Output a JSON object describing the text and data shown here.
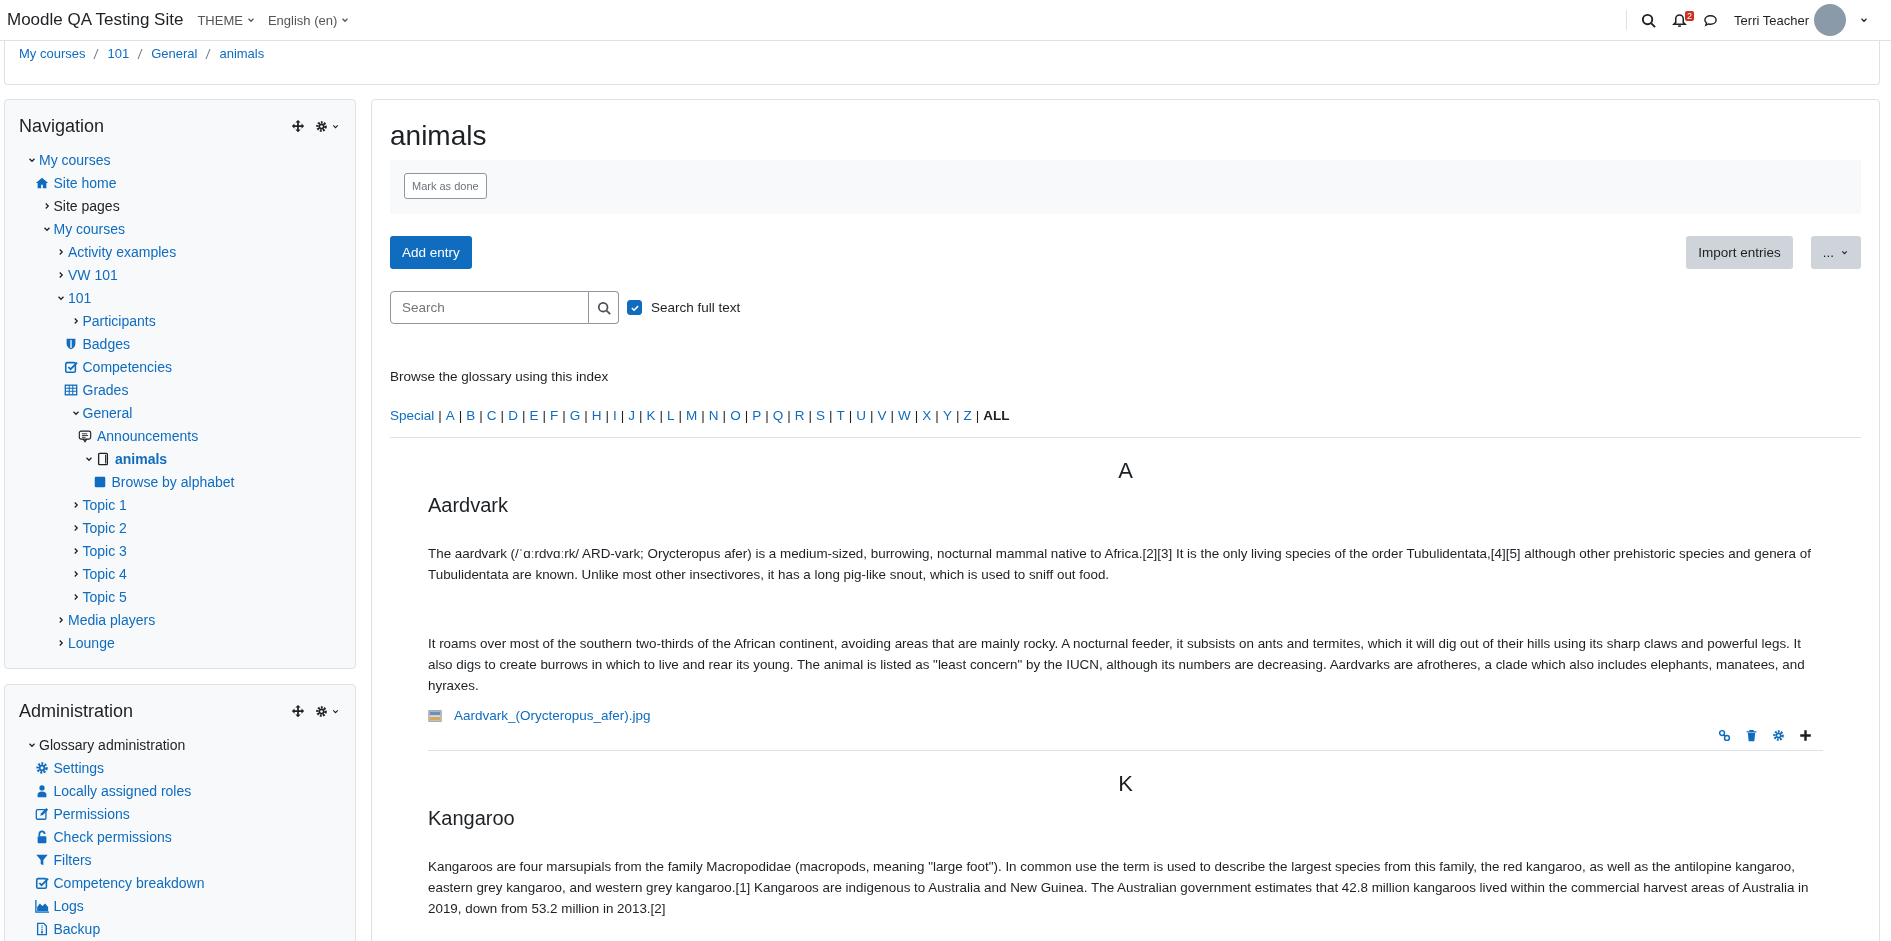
{
  "topbar": {
    "site_name": "Moodle QA Testing Site",
    "menus": [
      {
        "label": "THEME"
      },
      {
        "label": "English (en)"
      }
    ],
    "notification_count": "2",
    "user_name": "Terri Teacher"
  },
  "breadcrumb": [
    "My courses",
    "101",
    "General",
    "animals"
  ],
  "navigation": {
    "title": "Navigation",
    "items": [
      {
        "label": "My courses",
        "link": true,
        "current": false,
        "expanded": true,
        "children": [
          {
            "label": "Site home",
            "kind": "home",
            "link": true,
            "current": false
          },
          {
            "label": "Site pages",
            "link": false,
            "current": false,
            "expanded": false
          },
          {
            "label": "My courses",
            "link": true,
            "current": false,
            "expanded": true,
            "children": [
              {
                "label": "Activity examples",
                "link": true,
                "current": false,
                "expanded": false
              },
              {
                "label": "VW 101",
                "link": true,
                "current": false,
                "expanded": false
              },
              {
                "label": "101",
                "link": true,
                "current": false,
                "expanded": true,
                "children": [
                  {
                    "label": "Participants",
                    "link": true,
                    "current": false,
                    "expanded": false
                  },
                  {
                    "label": "Badges",
                    "kind": "badge",
                    "link": true,
                    "current": false
                  },
                  {
                    "label": "Competencies",
                    "kind": "check",
                    "link": true,
                    "current": false
                  },
                  {
                    "label": "Grades",
                    "kind": "grid",
                    "link": true,
                    "current": false
                  },
                  {
                    "label": "General",
                    "link": true,
                    "current": false,
                    "expanded": true,
                    "children": [
                      {
                        "label": "Announcements",
                        "kind": "forum",
                        "link": true,
                        "current": false
                      },
                      {
                        "label": "animals",
                        "kind": "book",
                        "link": true,
                        "current": true,
                        "expanded": true,
                        "children": [
                          {
                            "label": "Browse by alphabet",
                            "kind": "square",
                            "link": true,
                            "current": false
                          }
                        ]
                      }
                    ]
                  },
                  {
                    "label": "Topic 1",
                    "link": true,
                    "current": false,
                    "expanded": false
                  },
                  {
                    "label": "Topic 2",
                    "link": true,
                    "current": false,
                    "expanded": false
                  },
                  {
                    "label": "Topic 3",
                    "link": true,
                    "current": false,
                    "expanded": false
                  },
                  {
                    "label": "Topic 4",
                    "link": true,
                    "current": false,
                    "expanded": false
                  },
                  {
                    "label": "Topic 5",
                    "link": true,
                    "current": false,
                    "expanded": false
                  }
                ]
              },
              {
                "label": "Media players",
                "link": true,
                "current": false,
                "expanded": false
              },
              {
                "label": "Lounge",
                "link": true,
                "current": false,
                "expanded": false
              }
            ]
          }
        ]
      }
    ]
  },
  "administration": {
    "title": "Administration",
    "items": [
      {
        "label": "Glossary administration",
        "link": false,
        "current": false,
        "expanded": true,
        "children": [
          {
            "label": "Settings",
            "kind": "gear",
            "link": true,
            "current": false
          },
          {
            "label": "Locally assigned roles",
            "kind": "person",
            "link": true,
            "current": false
          },
          {
            "label": "Permissions",
            "kind": "edit",
            "link": true,
            "current": false
          },
          {
            "label": "Check permissions",
            "kind": "unlock",
            "link": true,
            "current": false
          },
          {
            "label": "Filters",
            "kind": "filter",
            "link": true,
            "current": false
          },
          {
            "label": "Competency breakdown",
            "kind": "check",
            "link": true,
            "current": false
          },
          {
            "label": "Logs",
            "kind": "chart",
            "link": true,
            "current": false
          },
          {
            "label": "Backup",
            "kind": "file",
            "link": true,
            "current": false
          }
        ]
      }
    ]
  },
  "main": {
    "title": "animals",
    "mark_done": "Mark as done",
    "add_entry": "Add entry",
    "import_entries": "Import entries",
    "more": "...",
    "search": {
      "placeholder": "Search"
    },
    "full_text": {
      "label": "Search full text",
      "checked": true
    },
    "browse_label": "Browse the glossary using this index",
    "alphabet": {
      "separator": "|",
      "items": [
        {
          "label": "Special",
          "selected": false
        },
        {
          "label": "A",
          "selected": false
        },
        {
          "label": "B",
          "selected": false
        },
        {
          "label": "C",
          "selected": false
        },
        {
          "label": "D",
          "selected": false
        },
        {
          "label": "E",
          "selected": false
        },
        {
          "label": "F",
          "selected": false
        },
        {
          "label": "G",
          "selected": false
        },
        {
          "label": "H",
          "selected": false
        },
        {
          "label": "I",
          "selected": false
        },
        {
          "label": "J",
          "selected": false
        },
        {
          "label": "K",
          "selected": false
        },
        {
          "label": "L",
          "selected": false
        },
        {
          "label": "M",
          "selected": false
        },
        {
          "label": "N",
          "selected": false
        },
        {
          "label": "O",
          "selected": false
        },
        {
          "label": "P",
          "selected": false
        },
        {
          "label": "Q",
          "selected": false
        },
        {
          "label": "R",
          "selected": false
        },
        {
          "label": "S",
          "selected": false
        },
        {
          "label": "T",
          "selected": false
        },
        {
          "label": "U",
          "selected": false
        },
        {
          "label": "V",
          "selected": false
        },
        {
          "label": "W",
          "selected": false
        },
        {
          "label": "X",
          "selected": false
        },
        {
          "label": "Y",
          "selected": false
        },
        {
          "label": "Z",
          "selected": false
        },
        {
          "label": "ALL",
          "selected": true
        }
      ]
    },
    "entries": [
      {
        "letter": "A",
        "term": "Aardvark",
        "paragraphs": [
          "The aardvark (/ˈɑːrdvɑːrk/ ARD-vark; Orycteropus afer) is a medium-sized, burrowing, nocturnal mammal native to Africa.[2][3] It is the only living species of the order Tubulidentata,[4][5] although other prehistoric species and genera of Tubulidentata are known. Unlike most other insectivores, it has a long pig-like snout, which is used to sniff out food.",
          "It roams over most of the southern two-thirds of the African continent, avoiding areas that are mainly rocky. A nocturnal feeder, it subsists on ants and termites, which it will dig out of their hills using its sharp claws and powerful legs. It also digs to create burrows in which to live and rear its young. The animal is listed as \"least concern\" by the IUCN, although its numbers are decreasing. Aardvarks are afrotheres, a clade which also includes elephants, manatees, and hyraxes."
        ],
        "attachment": "Aardvark_(Orycteropus_afer).jpg",
        "actions": true
      },
      {
        "letter": "K",
        "term": "Kangaroo",
        "paragraphs": [
          "Kangaroos are four marsupials from the family Macropodidae (macropods, meaning \"large foot\"). In common use the term is used to describe the largest species from this family, the red kangaroo, as well as the antilopine kangaroo, eastern grey kangaroo, and western grey kangaroo.[1] Kangaroos are indigenous to Australia and New Guinea. The Australian government estimates that 42.8 million kangaroos lived within the commercial harvest areas of Australia in 2019, down from 53.2 million in 2013.[2]"
        ],
        "actions": false
      }
    ]
  }
}
